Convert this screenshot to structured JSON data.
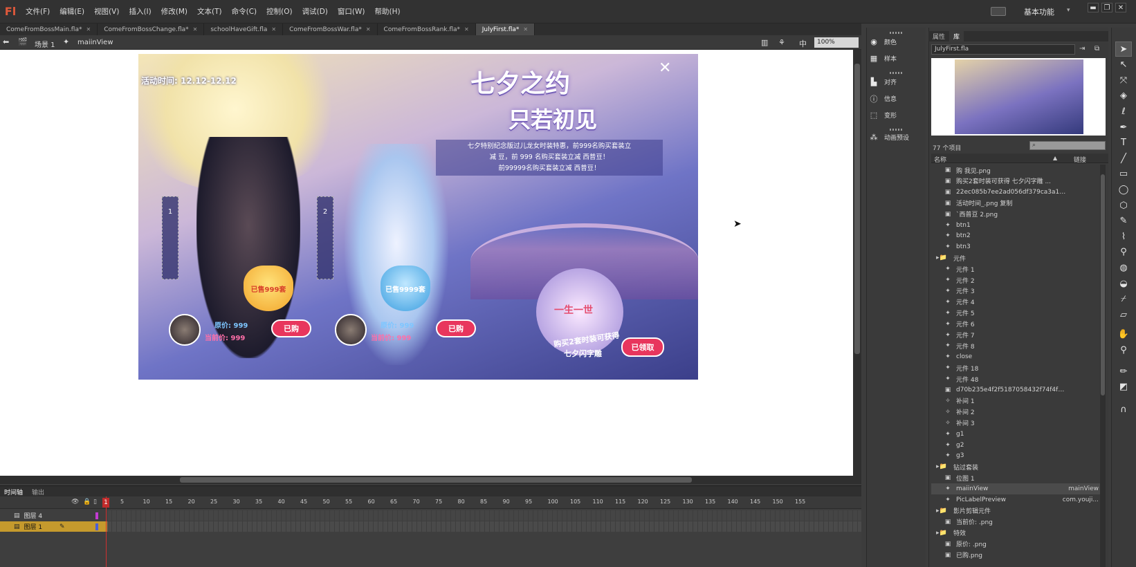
{
  "app": {
    "logo": "Fl",
    "workspace": "基本功能"
  },
  "menu": [
    "文件(F)",
    "编辑(E)",
    "视图(V)",
    "插入(I)",
    "修改(M)",
    "文本(T)",
    "命令(C)",
    "控制(O)",
    "调试(D)",
    "窗口(W)",
    "帮助(H)"
  ],
  "tabs": [
    {
      "label": "ComeFromBossMain.fla*",
      "active": false
    },
    {
      "label": "ComeFromBossChange.fla*",
      "active": false
    },
    {
      "label": "schoolHaveGift.fla",
      "active": false
    },
    {
      "label": "ComeFromBossWar.fla*",
      "active": false
    },
    {
      "label": "ComeFromBossRank.fla*",
      "active": false
    },
    {
      "label": "JulyFirst.fla*",
      "active": true
    }
  ],
  "editbar": {
    "scene": "场景 1",
    "symbol": "maiinView",
    "zoom": "100%",
    "center_label": "中"
  },
  "artboard": {
    "date": "活动时间: 12.12-12.12",
    "title1": "七夕之约",
    "title2": "只若初见",
    "desc_line1": "七夕特别纪念版过儿龙女时装特惠，前999名购买套装立",
    "desc_line2": "减 豆，前 999 名购买套装立减 西普豆！",
    "desc_line3": "前99999名购买套装立减 西普豆！",
    "slot1": "1",
    "slot2": "2",
    "sold1": "已售999套",
    "sold2": "已售9999套",
    "orig_label1": "原价: 999",
    "cur_label1": "当前价: 999",
    "orig_label2": "原价: 999",
    "cur_label2": "当前价: 999",
    "buy1": "已购",
    "buy2": "已购",
    "gift_text": "购买2套时装可获得",
    "gift_name": "七夕闪字雕",
    "claim": "已领取",
    "badge": "一生一世"
  },
  "timeline": {
    "tab1": "时间轴",
    "tab2": "输出",
    "frame_numbers": [
      "1",
      "5",
      "10",
      "15",
      "20",
      "25",
      "30",
      "35",
      "40",
      "45",
      "50",
      "55",
      "60",
      "65",
      "70",
      "75",
      "80",
      "85",
      "90",
      "95",
      "100",
      "105",
      "110",
      "115",
      "120",
      "125",
      "130",
      "135",
      "140",
      "145",
      "150",
      "155"
    ],
    "layers": [
      {
        "name": "图层 4",
        "selected": false
      },
      {
        "name": "图层 1",
        "selected": true
      }
    ]
  },
  "midpanel": [
    {
      "icon": "color-icon",
      "glyph": "◉",
      "label": "颜色"
    },
    {
      "icon": "swatches-icon",
      "glyph": "▦",
      "label": "样本"
    },
    {
      "icon": "align-icon",
      "glyph": "▙",
      "label": "对齐"
    },
    {
      "icon": "info-icon",
      "glyph": "ⓘ",
      "label": "信息"
    },
    {
      "icon": "transform-icon",
      "glyph": "⬚",
      "label": "变形"
    },
    {
      "icon": "motion-presets-icon",
      "glyph": "⁂",
      "label": "动画预设"
    }
  ],
  "library": {
    "tab_properties": "属性",
    "tab_library": "库",
    "file": "JulyFirst.fla",
    "count": "77 个项目",
    "col_name": "名称",
    "col_link": "链接",
    "items": [
      {
        "name": "购 我见.png",
        "icon": "▣",
        "link": "",
        "selected": false
      },
      {
        "name": "购买2套时装可获得 七夕闪字雕 ...",
        "icon": "▣",
        "link": "",
        "selected": false
      },
      {
        "name": "22ec085b7ee2ad056df379ca3a114...",
        "icon": "▣",
        "link": "",
        "selected": false
      },
      {
        "name": "活动时间_.png 复制",
        "icon": "▣",
        "link": "",
        "selected": false
      },
      {
        "name": "`西普豆 2.png",
        "icon": "▣",
        "link": "",
        "selected": false
      },
      {
        "name": "btn1",
        "icon": "✦",
        "link": "",
        "selected": false
      },
      {
        "name": "btn2",
        "icon": "✦",
        "link": "",
        "selected": false
      },
      {
        "name": "btn3",
        "icon": "✦",
        "link": "",
        "selected": false
      },
      {
        "name": "元件",
        "icon": "▸📁",
        "link": "",
        "selected": false
      },
      {
        "name": "元件 1",
        "icon": "✦",
        "link": "",
        "selected": false
      },
      {
        "name": "元件 2",
        "icon": "✦",
        "link": "",
        "selected": false
      },
      {
        "name": "元件 3",
        "icon": "✦",
        "link": "",
        "selected": false
      },
      {
        "name": "元件 4",
        "icon": "✦",
        "link": "",
        "selected": false
      },
      {
        "name": "元件 5",
        "icon": "✦",
        "link": "",
        "selected": false
      },
      {
        "name": "元件 6",
        "icon": "✦",
        "link": "",
        "selected": false
      },
      {
        "name": "元件 7",
        "icon": "✦",
        "link": "",
        "selected": false
      },
      {
        "name": "元件 8",
        "icon": "✦",
        "link": "",
        "selected": false
      },
      {
        "name": "close",
        "icon": "✦",
        "link": "",
        "selected": false
      },
      {
        "name": "元件 18",
        "icon": "✦",
        "link": "",
        "selected": false
      },
      {
        "name": "元件 48",
        "icon": "✦",
        "link": "",
        "selected": false
      },
      {
        "name": "d70b235e4f2f5187058432f74f4fe7...",
        "icon": "▣",
        "link": "",
        "selected": false
      },
      {
        "name": "补间 1",
        "icon": "✧",
        "link": "",
        "selected": false
      },
      {
        "name": "补间 2",
        "icon": "✧",
        "link": "",
        "selected": false
      },
      {
        "name": "补间 3",
        "icon": "✧",
        "link": "",
        "selected": false
      },
      {
        "name": "g1",
        "icon": "✦",
        "link": "",
        "selected": false
      },
      {
        "name": "g2",
        "icon": "✦",
        "link": "",
        "selected": false
      },
      {
        "name": "g3",
        "icon": "✦",
        "link": "",
        "selected": false
      },
      {
        "name": "钻过套装",
        "icon": "▸📁",
        "link": "",
        "selected": false
      },
      {
        "name": "位图 1",
        "icon": "▣",
        "link": "",
        "selected": false
      },
      {
        "name": "maiinView",
        "icon": "✦",
        "link": "mainView",
        "selected": true
      },
      {
        "name": "PicLabelPreview",
        "icon": "✦",
        "link": "com.youji...",
        "selected": false
      },
      {
        "name": "影片剪辑元件",
        "icon": "▸📁",
        "link": "",
        "selected": false
      },
      {
        "name": "当前价: .png",
        "icon": "▣",
        "link": "",
        "selected": false
      },
      {
        "name": "特效",
        "icon": "▸📁",
        "link": "",
        "selected": false
      },
      {
        "name": "原价: .png",
        "icon": "▣",
        "link": "",
        "selected": false
      },
      {
        "name": "已购.png",
        "icon": "▣",
        "link": "",
        "selected": false
      }
    ]
  },
  "tools": [
    {
      "name": "selection-tool-icon",
      "glyph": "➤",
      "selected": true
    },
    {
      "name": "subselection-tool-icon",
      "glyph": "↖",
      "selected": false
    },
    {
      "name": "free-transform-tool-icon",
      "glyph": "⤧",
      "selected": false
    },
    {
      "name": "3d-rotation-tool-icon",
      "glyph": "◈",
      "selected": false
    },
    {
      "name": "lasso-tool-icon",
      "glyph": "ℓ",
      "selected": false
    },
    {
      "name": "pen-tool-icon",
      "glyph": "✒",
      "selected": false
    },
    {
      "name": "text-tool-icon",
      "glyph": "T",
      "selected": false
    },
    {
      "name": "line-tool-icon",
      "glyph": "╱",
      "selected": false
    },
    {
      "name": "rectangle-tool-icon",
      "glyph": "▭",
      "selected": false
    },
    {
      "name": "oval-tool-icon",
      "glyph": "◯",
      "selected": false
    },
    {
      "name": "polystar-tool-icon",
      "glyph": "⬡",
      "selected": false
    },
    {
      "name": "pencil-tool-icon",
      "glyph": "✎",
      "selected": false
    },
    {
      "name": "brush-tool-icon",
      "glyph": "⌇",
      "selected": false
    },
    {
      "name": "bone-tool-icon",
      "glyph": "⚲",
      "selected": false
    },
    {
      "name": "paint-bucket-tool-icon",
      "glyph": "◍",
      "selected": false
    },
    {
      "name": "ink-bottle-tool-icon",
      "glyph": "◒",
      "selected": false
    },
    {
      "name": "eyedropper-tool-icon",
      "glyph": "⌿",
      "selected": false
    },
    {
      "name": "eraser-tool-icon",
      "glyph": "▱",
      "selected": false
    },
    {
      "name": "hand-tool-icon",
      "glyph": "✋",
      "selected": false
    },
    {
      "name": "zoom-tool-icon",
      "glyph": "⚲",
      "selected": false
    },
    {
      "name": "stroke-color-icon",
      "glyph": "✏",
      "selected": false
    },
    {
      "name": "fill-color-icon",
      "glyph": "◩",
      "selected": false
    },
    {
      "name": "snap-icon",
      "glyph": "∩",
      "selected": false
    }
  ]
}
